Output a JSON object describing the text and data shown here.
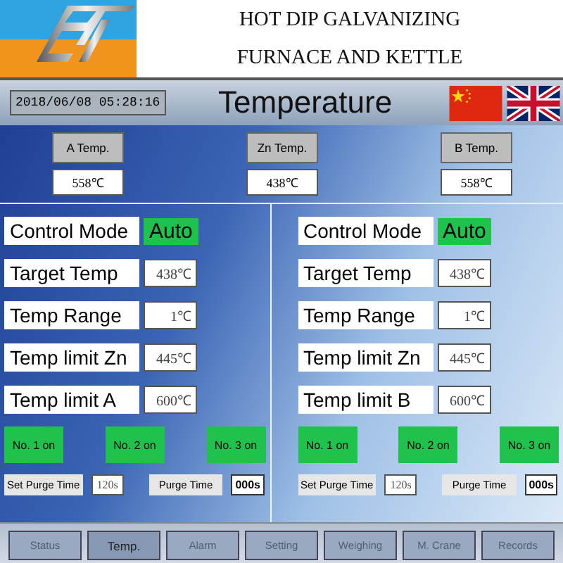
{
  "header": {
    "title_lines": [
      "HOT DIP GALVANIZING",
      "FURNACE AND KETTLE"
    ]
  },
  "title_bar": {
    "clock": "2018/06/08 05:28:16",
    "title": "Temperature"
  },
  "sensors": [
    {
      "label": "A Temp.",
      "value": "558℃"
    },
    {
      "label": "Zn Temp.",
      "value": "438℃"
    },
    {
      "label": "B Temp.",
      "value": "558℃"
    }
  ],
  "panels": [
    {
      "mode_label": "Control Mode",
      "mode_value": "Auto",
      "params": [
        {
          "label": "Target Temp",
          "value": "438℃"
        },
        {
          "label": "Temp  Range",
          "value": "1℃"
        },
        {
          "label": "Temp limit Zn",
          "value": "445℃"
        },
        {
          "label": "Temp limit A",
          "value": "600℃"
        }
      ],
      "burners": [
        {
          "label": "No. 1 on",
          "on": true
        },
        {
          "label": "No. 2 on",
          "on": true
        },
        {
          "label": "No. 3 on",
          "on": true
        }
      ],
      "set_purge_label": "Set Purge Time",
      "set_purge_value": "120s",
      "purge_label": "Purge Time",
      "purge_value": "000s"
    },
    {
      "mode_label": "Control Mode",
      "mode_value": "Auto",
      "params": [
        {
          "label": "Target Temp",
          "value": "438℃"
        },
        {
          "label": "Temp  Range",
          "value": "1℃"
        },
        {
          "label": "Temp limit Zn",
          "value": "445℃"
        },
        {
          "label": "Temp limit B",
          "value": "600℃"
        }
      ],
      "burners": [
        {
          "label": "No. 1 on",
          "on": true
        },
        {
          "label": "No. 2 on",
          "on": true
        },
        {
          "label": "No. 3 on",
          "on": true
        }
      ],
      "set_purge_label": "Set Purge Time",
      "set_purge_value": "120s",
      "purge_label": "Purge Time",
      "purge_value": "000s"
    }
  ],
  "tabs": [
    {
      "label": "Status",
      "selected": false
    },
    {
      "label": "Temp.",
      "selected": true
    },
    {
      "label": "Alarm",
      "selected": false
    },
    {
      "label": "Setting",
      "selected": false
    },
    {
      "label": "Weighing",
      "selected": false
    },
    {
      "label": "M. Crane",
      "selected": false
    },
    {
      "label": "Records",
      "selected": false
    }
  ]
}
